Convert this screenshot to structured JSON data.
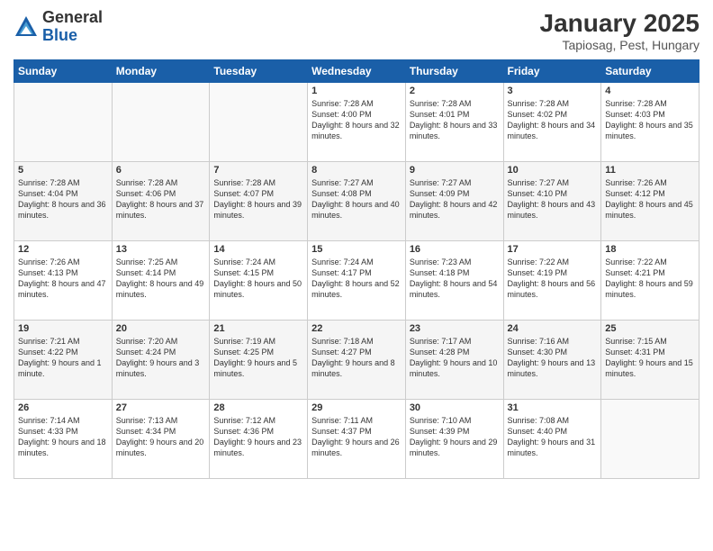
{
  "header": {
    "logo": {
      "general": "General",
      "blue": "Blue"
    },
    "title": "January 2025",
    "location": "Tapiosag, Pest, Hungary"
  },
  "weekdays": [
    "Sunday",
    "Monday",
    "Tuesday",
    "Wednesday",
    "Thursday",
    "Friday",
    "Saturday"
  ],
  "weeks": [
    [
      {
        "day": "",
        "sunrise": "",
        "sunset": "",
        "daylight": ""
      },
      {
        "day": "",
        "sunrise": "",
        "sunset": "",
        "daylight": ""
      },
      {
        "day": "",
        "sunrise": "",
        "sunset": "",
        "daylight": ""
      },
      {
        "day": "1",
        "sunrise": "Sunrise: 7:28 AM",
        "sunset": "Sunset: 4:00 PM",
        "daylight": "Daylight: 8 hours and 32 minutes."
      },
      {
        "day": "2",
        "sunrise": "Sunrise: 7:28 AM",
        "sunset": "Sunset: 4:01 PM",
        "daylight": "Daylight: 8 hours and 33 minutes."
      },
      {
        "day": "3",
        "sunrise": "Sunrise: 7:28 AM",
        "sunset": "Sunset: 4:02 PM",
        "daylight": "Daylight: 8 hours and 34 minutes."
      },
      {
        "day": "4",
        "sunrise": "Sunrise: 7:28 AM",
        "sunset": "Sunset: 4:03 PM",
        "daylight": "Daylight: 8 hours and 35 minutes."
      }
    ],
    [
      {
        "day": "5",
        "sunrise": "Sunrise: 7:28 AM",
        "sunset": "Sunset: 4:04 PM",
        "daylight": "Daylight: 8 hours and 36 minutes."
      },
      {
        "day": "6",
        "sunrise": "Sunrise: 7:28 AM",
        "sunset": "Sunset: 4:06 PM",
        "daylight": "Daylight: 8 hours and 37 minutes."
      },
      {
        "day": "7",
        "sunrise": "Sunrise: 7:28 AM",
        "sunset": "Sunset: 4:07 PM",
        "daylight": "Daylight: 8 hours and 39 minutes."
      },
      {
        "day": "8",
        "sunrise": "Sunrise: 7:27 AM",
        "sunset": "Sunset: 4:08 PM",
        "daylight": "Daylight: 8 hours and 40 minutes."
      },
      {
        "day": "9",
        "sunrise": "Sunrise: 7:27 AM",
        "sunset": "Sunset: 4:09 PM",
        "daylight": "Daylight: 8 hours and 42 minutes."
      },
      {
        "day": "10",
        "sunrise": "Sunrise: 7:27 AM",
        "sunset": "Sunset: 4:10 PM",
        "daylight": "Daylight: 8 hours and 43 minutes."
      },
      {
        "day": "11",
        "sunrise": "Sunrise: 7:26 AM",
        "sunset": "Sunset: 4:12 PM",
        "daylight": "Daylight: 8 hours and 45 minutes."
      }
    ],
    [
      {
        "day": "12",
        "sunrise": "Sunrise: 7:26 AM",
        "sunset": "Sunset: 4:13 PM",
        "daylight": "Daylight: 8 hours and 47 minutes."
      },
      {
        "day": "13",
        "sunrise": "Sunrise: 7:25 AM",
        "sunset": "Sunset: 4:14 PM",
        "daylight": "Daylight: 8 hours and 49 minutes."
      },
      {
        "day": "14",
        "sunrise": "Sunrise: 7:24 AM",
        "sunset": "Sunset: 4:15 PM",
        "daylight": "Daylight: 8 hours and 50 minutes."
      },
      {
        "day": "15",
        "sunrise": "Sunrise: 7:24 AM",
        "sunset": "Sunset: 4:17 PM",
        "daylight": "Daylight: 8 hours and 52 minutes."
      },
      {
        "day": "16",
        "sunrise": "Sunrise: 7:23 AM",
        "sunset": "Sunset: 4:18 PM",
        "daylight": "Daylight: 8 hours and 54 minutes."
      },
      {
        "day": "17",
        "sunrise": "Sunrise: 7:22 AM",
        "sunset": "Sunset: 4:19 PM",
        "daylight": "Daylight: 8 hours and 56 minutes."
      },
      {
        "day": "18",
        "sunrise": "Sunrise: 7:22 AM",
        "sunset": "Sunset: 4:21 PM",
        "daylight": "Daylight: 8 hours and 59 minutes."
      }
    ],
    [
      {
        "day": "19",
        "sunrise": "Sunrise: 7:21 AM",
        "sunset": "Sunset: 4:22 PM",
        "daylight": "Daylight: 9 hours and 1 minute."
      },
      {
        "day": "20",
        "sunrise": "Sunrise: 7:20 AM",
        "sunset": "Sunset: 4:24 PM",
        "daylight": "Daylight: 9 hours and 3 minutes."
      },
      {
        "day": "21",
        "sunrise": "Sunrise: 7:19 AM",
        "sunset": "Sunset: 4:25 PM",
        "daylight": "Daylight: 9 hours and 5 minutes."
      },
      {
        "day": "22",
        "sunrise": "Sunrise: 7:18 AM",
        "sunset": "Sunset: 4:27 PM",
        "daylight": "Daylight: 9 hours and 8 minutes."
      },
      {
        "day": "23",
        "sunrise": "Sunrise: 7:17 AM",
        "sunset": "Sunset: 4:28 PM",
        "daylight": "Daylight: 9 hours and 10 minutes."
      },
      {
        "day": "24",
        "sunrise": "Sunrise: 7:16 AM",
        "sunset": "Sunset: 4:30 PM",
        "daylight": "Daylight: 9 hours and 13 minutes."
      },
      {
        "day": "25",
        "sunrise": "Sunrise: 7:15 AM",
        "sunset": "Sunset: 4:31 PM",
        "daylight": "Daylight: 9 hours and 15 minutes."
      }
    ],
    [
      {
        "day": "26",
        "sunrise": "Sunrise: 7:14 AM",
        "sunset": "Sunset: 4:33 PM",
        "daylight": "Daylight: 9 hours and 18 minutes."
      },
      {
        "day": "27",
        "sunrise": "Sunrise: 7:13 AM",
        "sunset": "Sunset: 4:34 PM",
        "daylight": "Daylight: 9 hours and 20 minutes."
      },
      {
        "day": "28",
        "sunrise": "Sunrise: 7:12 AM",
        "sunset": "Sunset: 4:36 PM",
        "daylight": "Daylight: 9 hours and 23 minutes."
      },
      {
        "day": "29",
        "sunrise": "Sunrise: 7:11 AM",
        "sunset": "Sunset: 4:37 PM",
        "daylight": "Daylight: 9 hours and 26 minutes."
      },
      {
        "day": "30",
        "sunrise": "Sunrise: 7:10 AM",
        "sunset": "Sunset: 4:39 PM",
        "daylight": "Daylight: 9 hours and 29 minutes."
      },
      {
        "day": "31",
        "sunrise": "Sunrise: 7:08 AM",
        "sunset": "Sunset: 4:40 PM",
        "daylight": "Daylight: 9 hours and 31 minutes."
      },
      {
        "day": "",
        "sunrise": "",
        "sunset": "",
        "daylight": ""
      }
    ]
  ]
}
